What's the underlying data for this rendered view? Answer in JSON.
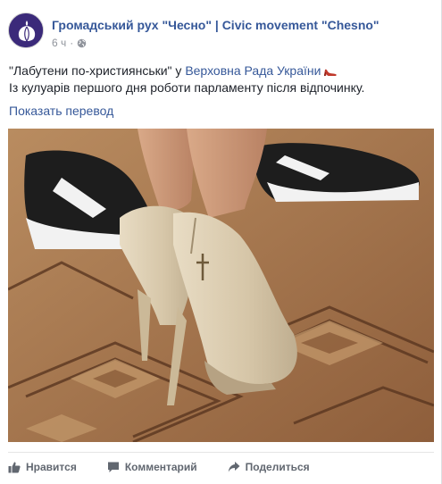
{
  "header": {
    "page_name": "Громадський рух \"Чесно\" | Civic movement \"Chesno\"",
    "time": "6 ч",
    "separator": "·",
    "privacy_icon": "globe-icon",
    "avatar_icon": "garlic-logo"
  },
  "post": {
    "text_part1": "\"Лабутени по-християнськи\" у ",
    "tagged_page": "Верховна Рада України",
    "emoji_icon": "high-heel-icon",
    "text_line2": "Із кулуарів першого дня роботи парламенту після відпочинку.",
    "translate_label": "Показать перевод"
  },
  "actions": {
    "like_label": "Нравится",
    "like_icon": "thumbs-up-icon",
    "comment_label": "Комментарий",
    "comment_icon": "comment-icon",
    "share_label": "Поделиться",
    "share_icon": "share-arrow-icon"
  },
  "colors": {
    "link": "#365899",
    "meta": "#90949c",
    "action_text": "#616770",
    "avatar_bg": "#3b2a7a"
  }
}
